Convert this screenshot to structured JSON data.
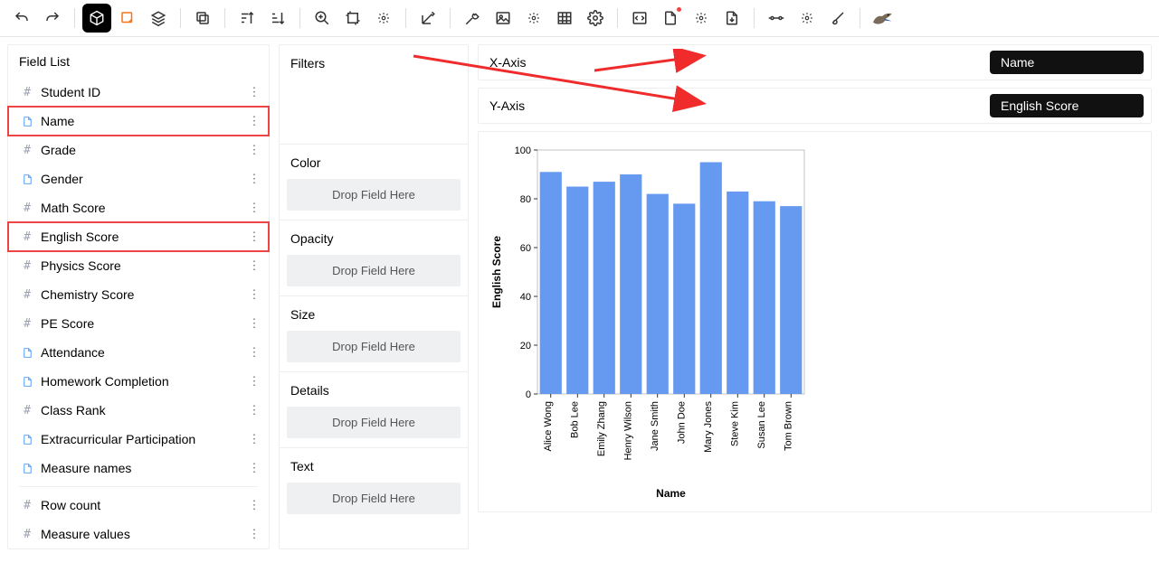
{
  "toolbar": {},
  "field_list": {
    "title": "Field List",
    "fields": [
      {
        "label": "Student ID",
        "kind": "num"
      },
      {
        "label": "Name",
        "kind": "txt",
        "highlighted": true
      },
      {
        "label": "Grade",
        "kind": "num"
      },
      {
        "label": "Gender",
        "kind": "txt"
      },
      {
        "label": "Math Score",
        "kind": "num"
      },
      {
        "label": "English Score",
        "kind": "num",
        "highlighted": true
      },
      {
        "label": "Physics Score",
        "kind": "num"
      },
      {
        "label": "Chemistry Score",
        "kind": "num"
      },
      {
        "label": "PE Score",
        "kind": "num"
      },
      {
        "label": "Attendance",
        "kind": "txt"
      },
      {
        "label": "Homework Completion",
        "kind": "txt"
      },
      {
        "label": "Class Rank",
        "kind": "num"
      },
      {
        "label": "Extracurricular Participation",
        "kind": "txt"
      },
      {
        "label": "Measure names",
        "kind": "txt"
      }
    ],
    "agg_fields": [
      {
        "label": "Row count",
        "kind": "num"
      },
      {
        "label": "Measure values",
        "kind": "num"
      }
    ]
  },
  "shelves": {
    "filters": {
      "title": "Filters"
    },
    "color": {
      "title": "Color",
      "placeholder": "Drop Field Here"
    },
    "opacity": {
      "title": "Opacity",
      "placeholder": "Drop Field Here"
    },
    "size": {
      "title": "Size",
      "placeholder": "Drop Field Here"
    },
    "details": {
      "title": "Details",
      "placeholder": "Drop Field Here"
    },
    "text": {
      "title": "Text",
      "placeholder": "Drop Field Here"
    }
  },
  "axes": {
    "x": {
      "label": "X-Axis",
      "pill": "Name"
    },
    "y": {
      "label": "Y-Axis",
      "pill": "English Score"
    }
  },
  "chart_data": {
    "type": "bar",
    "title": "",
    "xlabel": "Name",
    "ylabel": "English Score",
    "ylim": [
      0,
      100
    ],
    "yticks": [
      0,
      20,
      40,
      60,
      80,
      100
    ],
    "categories": [
      "Alice Wong",
      "Bob Lee",
      "Emily Zhang",
      "Henry Wilson",
      "Jane Smith",
      "John Doe",
      "Mary Jones",
      "Steve Kim",
      "Susan Lee",
      "Tom Brown"
    ],
    "values": [
      91,
      85,
      87,
      90,
      82,
      78,
      95,
      83,
      79,
      77
    ],
    "bar_color": "#6699f0"
  }
}
